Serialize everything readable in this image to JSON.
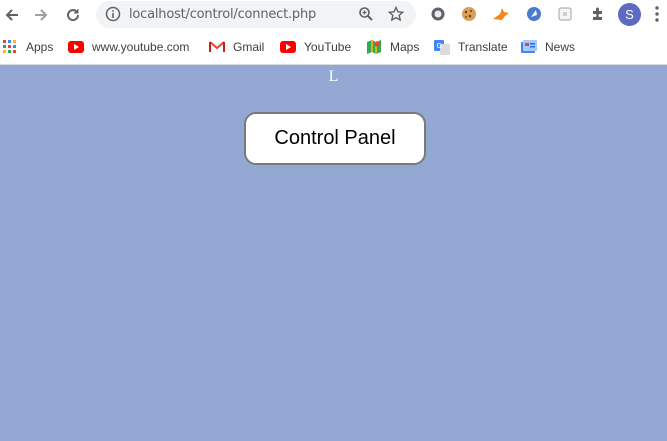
{
  "browser": {
    "url": "localhost/control/connect.php",
    "profile_initial": "S"
  },
  "bookmarks": [
    {
      "label": "Apps",
      "icon": "apps-grid-icon"
    },
    {
      "label": "www.youtube.com",
      "icon": "youtube-icon"
    },
    {
      "label": "Gmail",
      "icon": "gmail-icon"
    },
    {
      "label": "YouTube",
      "icon": "youtube-icon"
    },
    {
      "label": "Maps",
      "icon": "maps-icon"
    },
    {
      "label": "Translate",
      "icon": "translate-icon"
    },
    {
      "label": "News",
      "icon": "news-icon"
    }
  ],
  "page": {
    "heading_letter": "L",
    "button_label": "Control Panel",
    "background_color": "#93a8d3"
  }
}
